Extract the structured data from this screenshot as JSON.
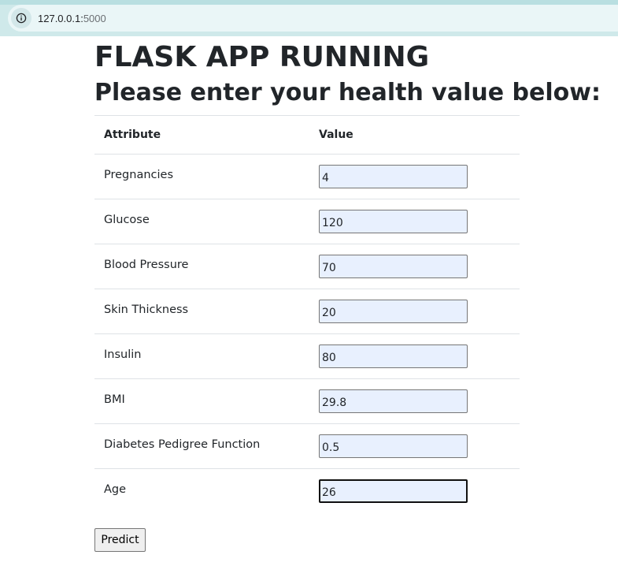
{
  "browser": {
    "url_host": "127.0.0.1:",
    "url_port": "5000",
    "info_icon": "info-icon"
  },
  "page": {
    "title": "FLASK APP RUNNING",
    "subtitle": "Please enter your health value below:"
  },
  "table": {
    "headers": {
      "attribute": "Attribute",
      "value": "Value"
    },
    "rows": [
      {
        "label": "Pregnancies",
        "value": "4"
      },
      {
        "label": "Glucose",
        "value": "120"
      },
      {
        "label": "Blood Pressure",
        "value": "70"
      },
      {
        "label": "Skin Thickness",
        "value": "20"
      },
      {
        "label": "Insulin",
        "value": "80"
      },
      {
        "label": "BMI",
        "value": "29.8"
      },
      {
        "label": "Diabetes Pedigree Function",
        "value": "0.5"
      },
      {
        "label": "Age",
        "value": "26"
      }
    ]
  },
  "form": {
    "submit_label": "Predict"
  }
}
